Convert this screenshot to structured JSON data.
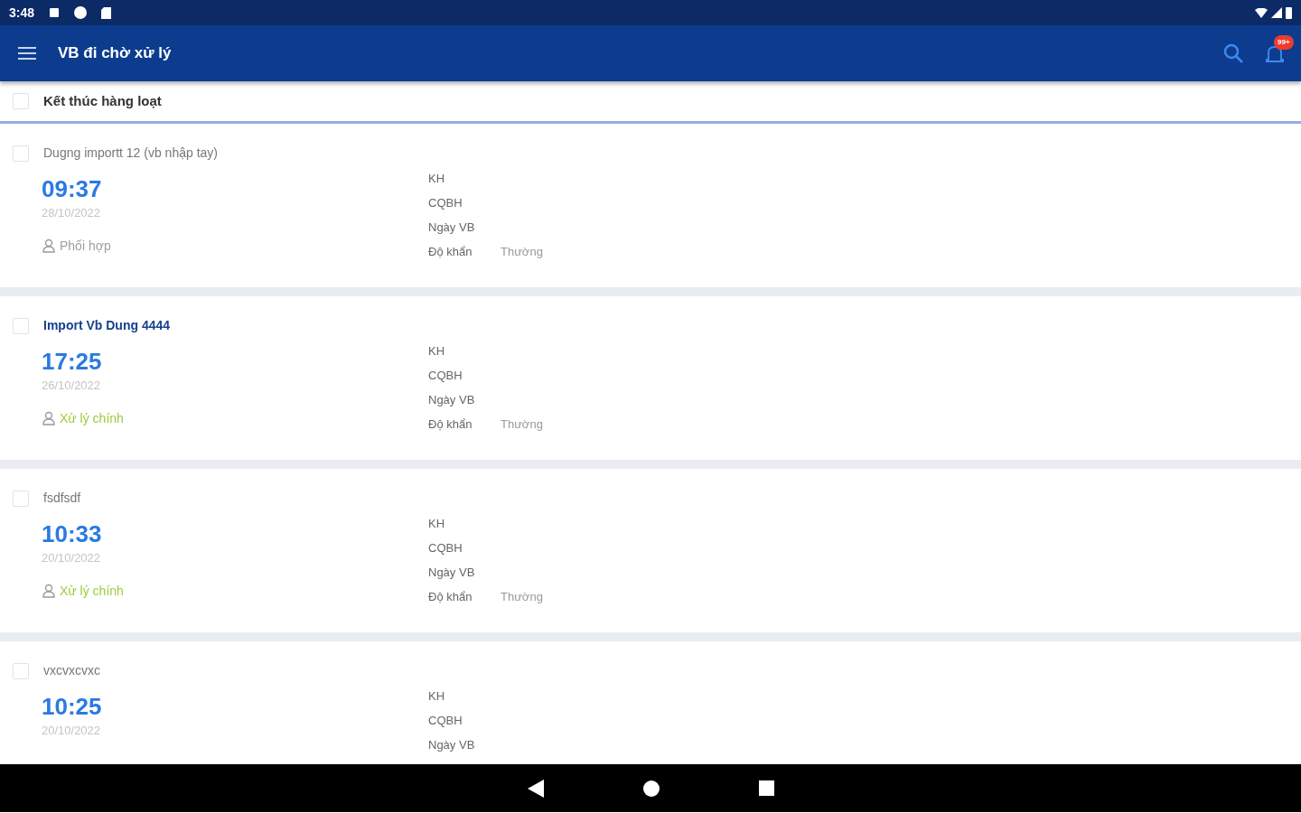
{
  "status_bar": {
    "time": "3:48"
  },
  "app_bar": {
    "title": "VB đi chờ xử lý",
    "notification_badge": "99+"
  },
  "bulk_action": {
    "label": "Kết thúc hàng loạt",
    "checked": false
  },
  "documents": [
    {
      "title": "Dugng importt 12 (vb nhập tay)",
      "unread": false,
      "checked": false,
      "time": "09:37",
      "date": "28/10/2022",
      "role": {
        "label": "Phối hợp",
        "color": "#9e9e9e"
      },
      "fields": [
        {
          "label": "KH"
        },
        {
          "label": "CQBH"
        },
        {
          "label": "Ngày VB"
        },
        {
          "label": "Độ khẩn",
          "value": "Thường"
        }
      ]
    },
    {
      "title": "Import Vb Dung 4444",
      "unread": true,
      "checked": false,
      "time": "17:25",
      "date": "26/10/2022",
      "role": {
        "label": "Xử lý chính",
        "color": "#9ccc3c"
      },
      "fields": [
        {
          "label": "KH"
        },
        {
          "label": "CQBH"
        },
        {
          "label": "Ngày VB"
        },
        {
          "label": "Độ khẩn",
          "value": "Thường"
        }
      ]
    },
    {
      "title": "fsdfsdf",
      "unread": false,
      "checked": false,
      "time": "10:33",
      "date": "20/10/2022",
      "role": {
        "label": "Xử lý chính",
        "color": "#9ccc3c"
      },
      "fields": [
        {
          "label": "KH"
        },
        {
          "label": "CQBH"
        },
        {
          "label": "Ngày VB"
        },
        {
          "label": "Độ khẩn",
          "value": "Thường"
        }
      ]
    },
    {
      "title": "vxcvxcvxc",
      "unread": false,
      "checked": false,
      "time": "10:25",
      "date": "20/10/2022",
      "fields": [
        {
          "label": "KH"
        },
        {
          "label": "CQBH"
        },
        {
          "label": "Ngày VB"
        }
      ]
    }
  ]
}
